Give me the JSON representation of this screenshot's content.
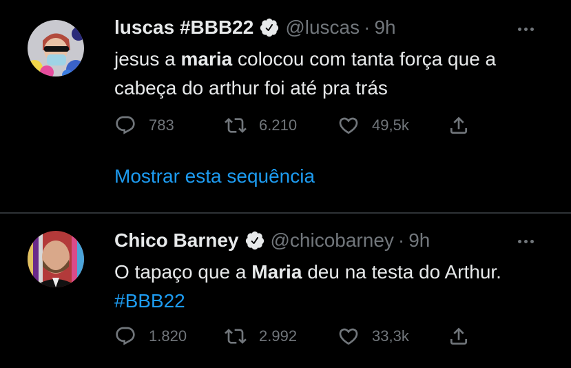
{
  "tweets": [
    {
      "name": "luscas #BBB22",
      "handle": "@luscas",
      "dot": "·",
      "time": "9h",
      "text_parts": [
        "jesus a ",
        "maria",
        " colocou com tanta força que a cabeça do arthur foi até pra trás"
      ],
      "replies": "783",
      "retweets": "6.210",
      "likes": "49,5k",
      "show_thread": "Mostrar esta sequência"
    },
    {
      "name": "Chico Barney",
      "handle": "@chicobarney",
      "dot": "·",
      "time": "9h",
      "text_parts": [
        "O tapaço que a ",
        "Maria",
        " deu na testa do Arthur. ",
        "#BBB22"
      ],
      "replies": "1.820",
      "retweets": "2.992",
      "likes": "33,3k"
    }
  ],
  "icons": {
    "verified": "verified-badge-icon",
    "more": "more-options-icon",
    "reply": "reply-icon",
    "retweet": "retweet-icon",
    "like": "like-icon",
    "share": "share-icon"
  },
  "colors": {
    "background": "#000000",
    "text": "#e7e9ea",
    "secondary": "#71767b",
    "link": "#1d9bf0",
    "divider": "#2f3336"
  }
}
